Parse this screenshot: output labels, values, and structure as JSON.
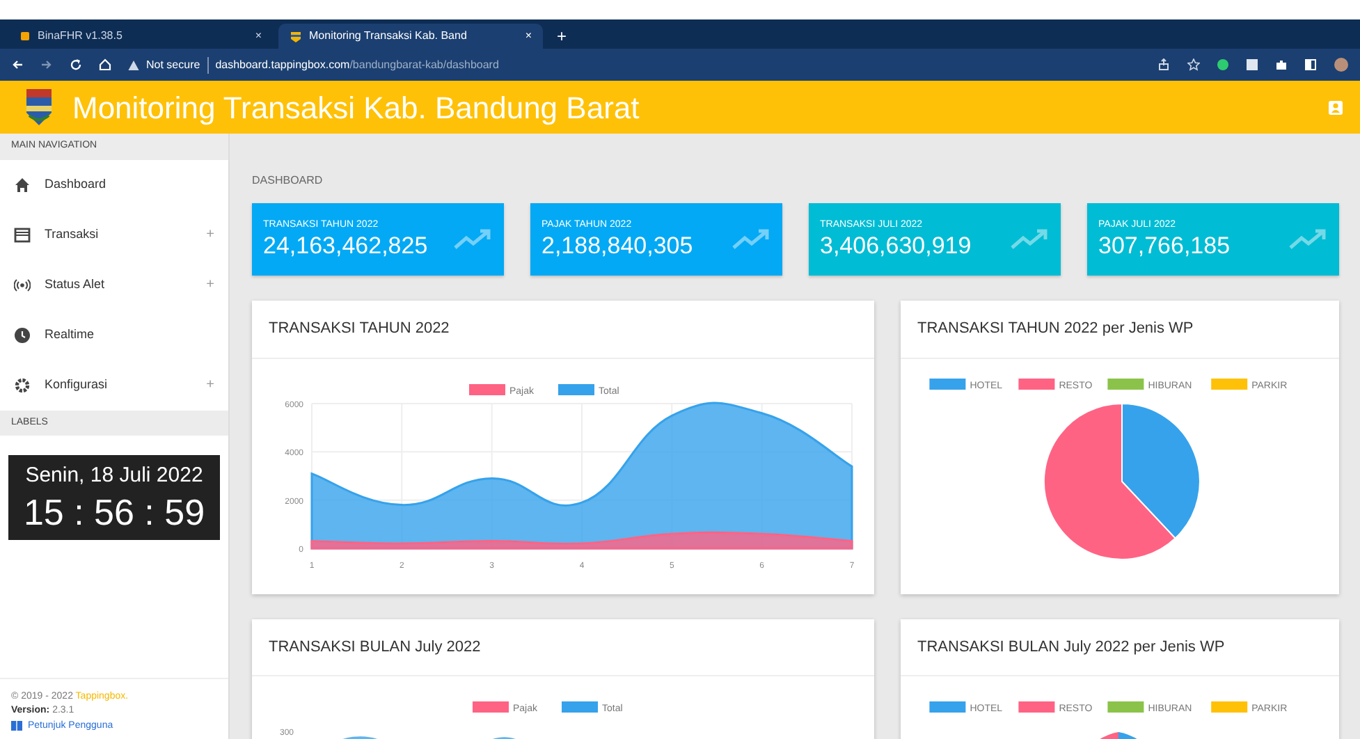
{
  "browser": {
    "tabs": [
      {
        "title": "BinaFHR v1.38.5",
        "close": "×",
        "selected": false
      },
      {
        "title": "Monitoring Transaksi Kab. Band",
        "close": "×",
        "selected": true
      }
    ],
    "new_tab": "+",
    "security": "Not secure",
    "url_host": "dashboard.tappingbox.com",
    "url_path": "/bandungbarat-kab/dashboard"
  },
  "header": {
    "title": "Monitoring Transaksi Kab. Bandung Barat"
  },
  "sidebar": {
    "nav_heading": "MAIN NAVIGATION",
    "items": [
      {
        "label": "Dashboard"
      },
      {
        "label": "Transaksi",
        "toggle": "+"
      },
      {
        "label": "Status Alet",
        "toggle": "+"
      },
      {
        "label": "Realtime"
      },
      {
        "label": "Konfigurasi",
        "toggle": "+"
      }
    ],
    "labels_heading": "LABELS",
    "clock": {
      "date": "Senin, 18 Juli 2022",
      "time": "15 : 56 : 59"
    },
    "footer": {
      "copyright": "© 2019 - 2022",
      "brand": "Tappingbox.",
      "version_label": "Version:",
      "version": "2.3.1",
      "guide_link": "Petunjuk Pengguna"
    }
  },
  "page_heading": "DASHBOARD",
  "info_boxes": [
    {
      "label": "TRANSAKSI TAHUN 2022",
      "value": "24,163,462,825",
      "color": "#03a9f4"
    },
    {
      "label": "PAJAK TAHUN 2022",
      "value": "2,188,840,305",
      "color": "#03a9f4"
    },
    {
      "label": "TRANSAKSI JULI 2022",
      "value": "3,406,630,919",
      "color": "#00bcd4"
    },
    {
      "label": "PAJAK JULI 2022",
      "value": "307,766,185",
      "color": "#00bcd4"
    }
  ],
  "cards": [
    {
      "title": "TRANSAKSI TAHUN 2022",
      "chart_data": {
        "type": "area",
        "categories": [
          "1",
          "2",
          "3",
          "4",
          "5",
          "6",
          "7"
        ],
        "yticks": [
          0,
          2000,
          4000,
          6000
        ],
        "ylim": [
          0,
          6000
        ],
        "grid": true,
        "legend": true,
        "series": [
          {
            "name": "Pajak",
            "color": "#ff6384",
            "values": [
              300,
              200,
              300,
              200,
              600,
              600,
              300
            ]
          },
          {
            "name": "Total",
            "color": "#36a2eb",
            "values": [
              3100,
              1800,
              2900,
              1900,
              5500,
              5600,
              3400
            ]
          }
        ]
      }
    },
    {
      "title": "TRANSAKSI TAHUN 2022 per Jenis WP",
      "chart_data": {
        "type": "pie",
        "categories": [
          "HOTEL",
          "RESTO",
          "HIBURAN",
          "PARKIR"
        ],
        "legend": true,
        "series": [
          {
            "colors": [
              "#36a2eb",
              "#ff6384",
              "#8bc34a",
              "#ffc107"
            ],
            "values": [
              38,
              62,
              0,
              0
            ]
          }
        ]
      }
    },
    {
      "title": "TRANSAKSI BULAN July 2022",
      "legend": [
        {
          "label": "Pajak",
          "color": "#ff6384"
        },
        {
          "label": "Total",
          "color": "#36a2eb"
        }
      ],
      "top_tick": "300",
      "kind": "line"
    },
    {
      "title": "TRANSAKSI BULAN July 2022 per Jenis WP",
      "legend": [
        {
          "label": "HOTEL",
          "color": "#36a2eb"
        },
        {
          "label": "RESTO",
          "color": "#ff6384"
        },
        {
          "label": "HIBURAN",
          "color": "#8bc34a"
        },
        {
          "label": "PARKIR",
          "color": "#ffc107"
        }
      ],
      "kind": "pie"
    }
  ]
}
